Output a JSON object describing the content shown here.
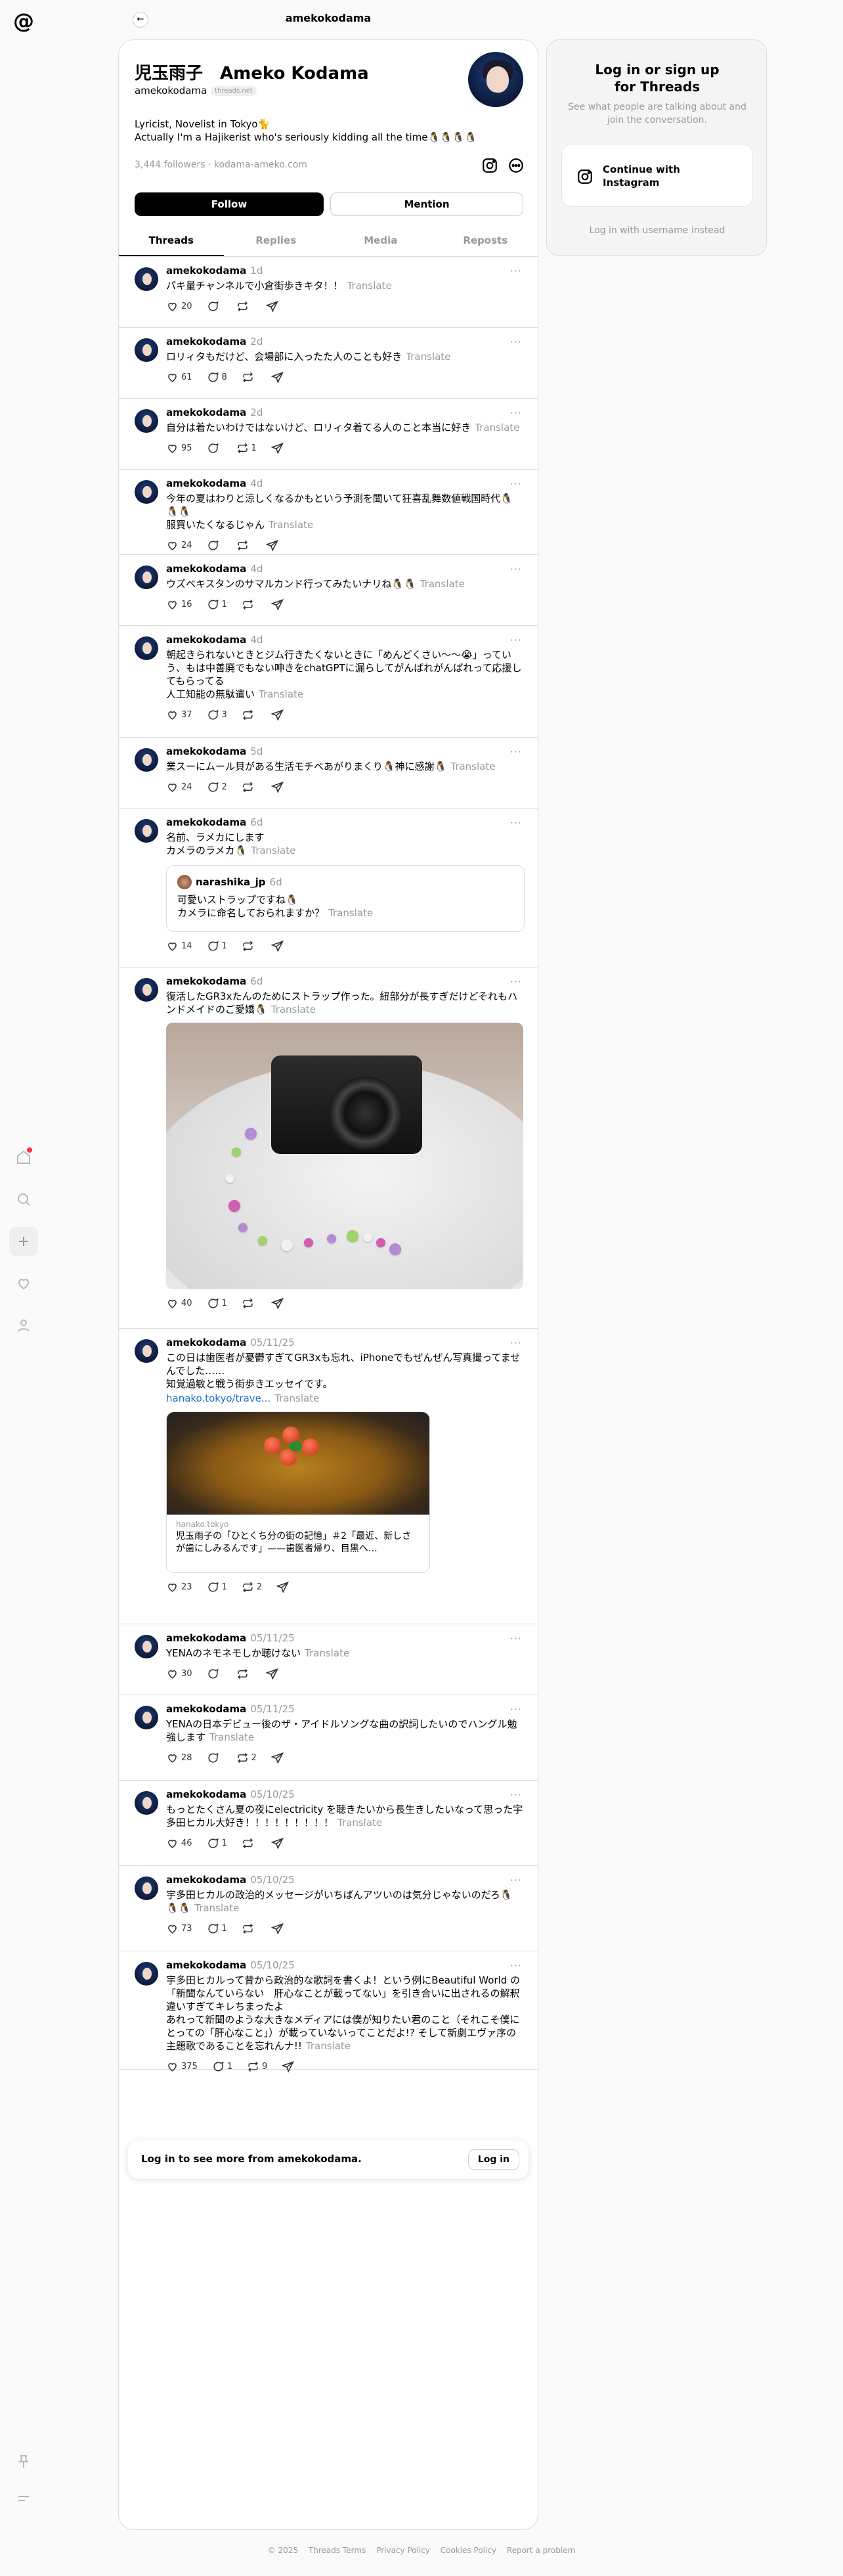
{
  "header": {
    "title": "amekokodama",
    "back_icon": "arrow-left-icon"
  },
  "sidebar": {
    "logo": "threads-logo",
    "items": [
      "home-icon",
      "search-icon",
      "create-icon",
      "activity-icon",
      "profile-icon"
    ],
    "bottom": [
      "pin-icon",
      "menu-icon"
    ]
  },
  "profile": {
    "name": "児玉雨子　Ameko Kodama",
    "handle": "amekokodama",
    "badge": "threads.net",
    "bio": "Lyricist, Novelist in Tokyo🐈\nActually I'm a Hajikerist who's seriously kidding all the time🐧🐧🐧🐧",
    "followers": "3,444 followers",
    "link": "kodama-ameko.com",
    "follow_label": "Follow",
    "mention_label": "Mention"
  },
  "tabs": [
    "Threads",
    "Replies",
    "Media",
    "Reposts"
  ],
  "translate": "Translate",
  "posts": [
    {
      "user": "amekokodama",
      "time": "1d",
      "text": "パキ量チャンネルで小倉街歩きキタ！！",
      "likes": "20",
      "replies": "",
      "reposts": ""
    },
    {
      "user": "amekokodama",
      "time": "2d",
      "text": "ロリィタもだけど、会場部に入ったた人のことも好き",
      "likes": "61",
      "replies": "8",
      "reposts": ""
    },
    {
      "user": "amekokodama",
      "time": "2d",
      "text": "自分は着たいわけではないけど、ロリィタ着てる人のこと本当に好き",
      "likes": "95",
      "replies": "",
      "reposts": "1"
    },
    {
      "user": "amekokodama",
      "time": "4d",
      "text": "今年の夏はわりと涼しくなるかもという予測を聞いて狂喜乱舞数値戦国時代🐧🐧🐧\n服買いたくなるじゃん",
      "likes": "24",
      "replies": "",
      "reposts": ""
    },
    {
      "user": "amekokodama",
      "time": "4d",
      "text": "ウズベキスタンのサマルカンド行ってみたいナリね🐧🐧",
      "likes": "16",
      "replies": "1",
      "reposts": ""
    },
    {
      "user": "amekokodama",
      "time": "4d",
      "text": "朝起きられないときとジム行きたくないときに「めんどくさい〜〜😭」っていう、もは中善廃でもない呻きをchatGPTに漏らしてがんばれがんばれって応援してもらってる\n人工知能の無駄遣い",
      "likes": "37",
      "replies": "3",
      "reposts": ""
    },
    {
      "user": "amekokodama",
      "time": "5d",
      "text": "業スーにムール貝がある生活モチベあがりまくり🐧神に感謝🐧",
      "likes": "24",
      "replies": "2",
      "reposts": ""
    },
    {
      "user": "amekokodama",
      "time": "6d",
      "text": "名前、ラメカにします\nカメラのラメカ🐧",
      "likes": "14",
      "replies": "1",
      "reposts": "",
      "quote": {
        "user": "narashika_jp",
        "time": "6d",
        "text": "可愛いストラップですね🐧\nカメラに命名しておられますか？"
      }
    },
    {
      "user": "amekokodama",
      "time": "6d",
      "text": "復活したGR3xたんのためにストラップ作った。紐部分が長すぎだけどそれもハンドメイドのご愛嬌🐧",
      "likes": "40",
      "replies": "1",
      "reposts": ""
    },
    {
      "user": "amekokodama",
      "time": "05/11/25",
      "text": "この日は歯医者が憂鬱すぎてGR3xも忘れ、iPhoneでもぜんぜん写真撮ってませんでした……\n知覚過敏と戦う街歩きエッセイです。",
      "link": "hanako.tokyo/trave...",
      "likes": "23",
      "replies": "1",
      "reposts": "2",
      "card": {
        "domain": "hanako.tokyo",
        "title": "児玉雨子の「ひとくち分の街の記憶」＃2「最近、新しさが歯にしみるんです」——歯医者帰り、目黒へ…"
      }
    },
    {
      "user": "amekokodama",
      "time": "05/11/25",
      "text": "YENAのネモネモしか聴けない",
      "likes": "30",
      "replies": "",
      "reposts": ""
    },
    {
      "user": "amekokodama",
      "time": "05/11/25",
      "text": "YENAの日本デビュー後のザ・アイドルソングな曲の訳詞したいのでハングル勉強します",
      "likes": "28",
      "replies": "",
      "reposts": "2"
    },
    {
      "user": "amekokodama",
      "time": "05/10/25",
      "text": "もっとたくさん夏の夜にelectricity を聴きたいから長生きしたいなって思った宇多田ヒカル大好き！！！！！！！！！",
      "likes": "46",
      "replies": "1",
      "reposts": ""
    },
    {
      "user": "amekokodama",
      "time": "05/10/25",
      "text": "宇多田ヒカルの政治的メッセージがいちばんアツいのは気分じゃないのだろ🐧🐧🐧",
      "likes": "73",
      "replies": "1",
      "reposts": ""
    },
    {
      "user": "amekokodama",
      "time": "05/10/25",
      "text": "宇多田ヒカルって昔から政治的な歌詞を書くよ！という例にBeautiful World の「新聞なんていらない　肝心なことが載ってない」を引き合いに出されるの解釈違いすぎてキレちまったよ\nあれって新聞のような大きなメディアには僕が知りたい君のこと（それこそ僕にとっての「肝心なこと」）が載っていないってことだよ!? そして新劇エヴァ序の主題歌であることを忘れんナ!!",
      "likes": "375",
      "replies": "1",
      "reposts": "9"
    }
  ],
  "login_bar": {
    "text": "Log in to see more from amekokodama.",
    "button": "Log in"
  },
  "right_card": {
    "title": "Log in or sign up for Threads",
    "subtitle": "See what people are talking about and join the conversation.",
    "ig_button": "Continue with Instagram",
    "alt": "Log in with username instead"
  },
  "footer": [
    "© 2025",
    "Threads Terms",
    "Privacy Policy",
    "Cookies Policy",
    "Report a problem"
  ]
}
